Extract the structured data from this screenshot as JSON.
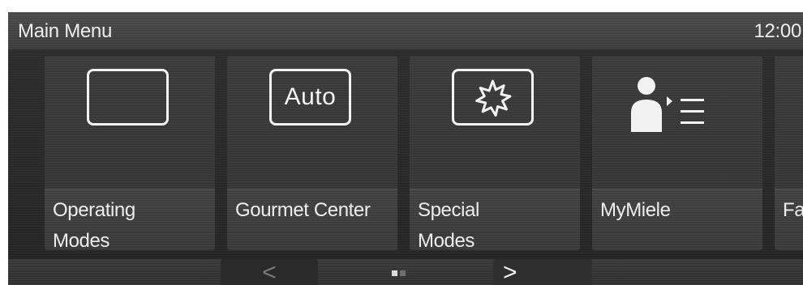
{
  "header": {
    "title": "Main Menu",
    "clock": "12:00"
  },
  "tiles": [
    {
      "label": "Operating\nModes",
      "icon": "empty-oven-icon"
    },
    {
      "label": "Gourmet Center",
      "icon": "auto-icon",
      "icon_text": "Auto"
    },
    {
      "label": "Special\nModes",
      "icon": "special-modes-star-icon"
    },
    {
      "label": "MyMiele",
      "icon": "user-list-icon"
    },
    {
      "label": "Fa",
      "icon": ""
    }
  ],
  "navigation": {
    "prev_label": "<",
    "next_label": ">",
    "page_current": 1,
    "page_total": 2
  },
  "colors": {
    "background": "#282828",
    "header": "#434343",
    "tile": "#363636",
    "text": "#ededed",
    "icon": "#f2f2f2",
    "active_dot": "#dcdcdc",
    "inactive_dot": "#6e6e6e"
  }
}
